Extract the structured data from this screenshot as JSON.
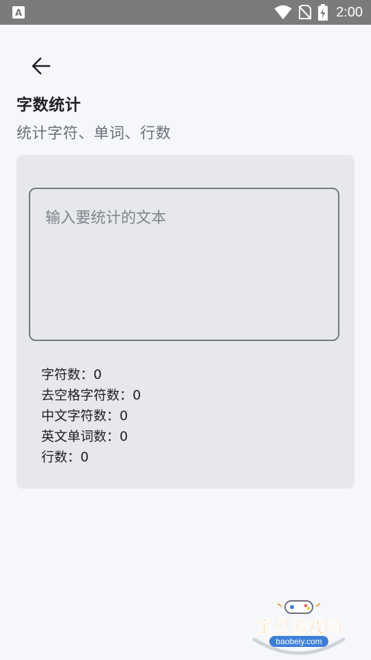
{
  "status_bar": {
    "time": "2:00",
    "icons": [
      "notification-a-icon",
      "wifi-icon",
      "no-sim-icon",
      "battery-charging-icon"
    ]
  },
  "header": {
    "back_icon": "arrow-left-icon",
    "title": "字数统计",
    "subtitle": "统计字符、单词、行数"
  },
  "input": {
    "value": "",
    "placeholder": "输入要统计的文本"
  },
  "stats": [
    {
      "label": "字符数：",
      "value": "0"
    },
    {
      "label": "去空格字符数：",
      "value": "0"
    },
    {
      "label": "中文字符数：",
      "value": "0"
    },
    {
      "label": "英文单词数：",
      "value": "0"
    },
    {
      "label": "行数：",
      "value": "0"
    }
  ],
  "watermark": {
    "title": "宝贝游戏网",
    "url": "baobeiy.com"
  },
  "colors": {
    "background": "#f6f7fa",
    "card": "#e7e8eb",
    "status_bar": "#7b7b7b",
    "input_border": "#73777f",
    "watermark_text": "#f2a43a",
    "watermark_badge": "#3d7fd8"
  }
}
